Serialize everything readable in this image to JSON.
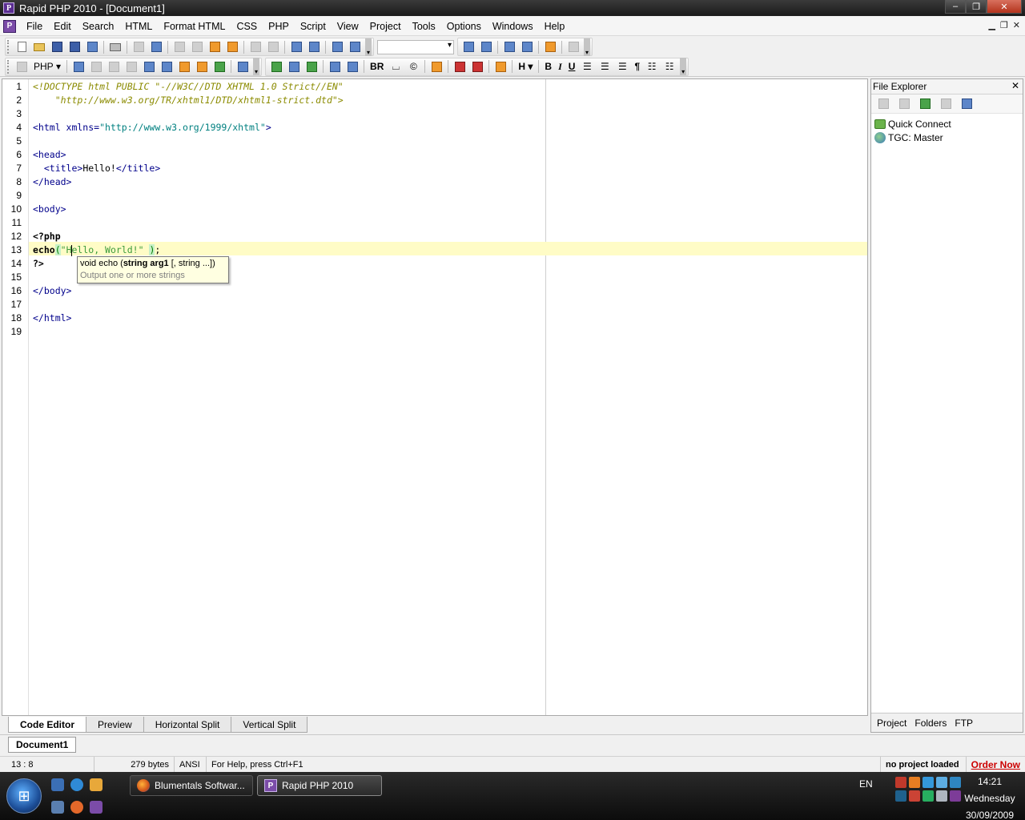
{
  "window": {
    "title": "Rapid PHP 2010 - [Document1]",
    "minimize": "‒",
    "maximize": "❐",
    "close": "✕"
  },
  "menu": [
    "File",
    "Edit",
    "Search",
    "HTML",
    "Format HTML",
    "CSS",
    "PHP",
    "Script",
    "View",
    "Project",
    "Tools",
    "Options",
    "Windows",
    "Help"
  ],
  "toolbar2": {
    "php_label": "PHP",
    "br_label": "BR",
    "h_label": "H",
    "bold": "B",
    "italic": "I",
    "underline": "U",
    "pilcrow": "¶"
  },
  "editor": {
    "lines": [
      {
        "n": "1"
      },
      {
        "n": "2"
      },
      {
        "n": "3"
      },
      {
        "n": "4"
      },
      {
        "n": "5"
      },
      {
        "n": "6"
      },
      {
        "n": "7"
      },
      {
        "n": "8"
      },
      {
        "n": "9"
      },
      {
        "n": "10"
      },
      {
        "n": "11"
      },
      {
        "n": "12"
      },
      {
        "n": "13"
      },
      {
        "n": "14"
      },
      {
        "n": "15"
      },
      {
        "n": "16"
      },
      {
        "n": "17"
      },
      {
        "n": "18"
      },
      {
        "n": "19"
      }
    ],
    "code": {
      "l1": "<!DOCTYPE html PUBLIC \"-//W3C//DTD XHTML 1.0 Strict//EN\"",
      "l2": "    \"http://www.w3.org/TR/xhtml1/DTD/xhtml1-strict.dtd\">",
      "l4_open": "<html xmlns=",
      "l4_val": "\"http://www.w3.org/1999/xhtml\"",
      "l4_close": ">",
      "l6": "<head>",
      "l7_open": "  <title>",
      "l7_text": "Hello!",
      "l7_close": "</title>",
      "l8": "</head>",
      "l10": "<body>",
      "l12": "<?php",
      "l13_kw": "echo",
      "l13_paren_open": "(",
      "l13_str_a": "\"H",
      "l13_str_b": "ello, World!\" ",
      "l13_paren_close": ")",
      "l13_end": ";",
      "l14": "?>",
      "l16": "</body>",
      "l18": "</html>"
    },
    "tooltip": {
      "sig_pre": "void echo (",
      "sig_bold": "string arg1",
      "sig_post": " [, string ...])",
      "desc": "Output one or more strings"
    }
  },
  "editor_tabs": [
    "Code Editor",
    "Preview",
    "Horizontal Split",
    "Vertical Split"
  ],
  "file_explorer": {
    "title": "File Explorer",
    "close": "✕",
    "items": [
      "Quick Connect",
      "TGC: Master"
    ],
    "tabs": [
      "Project",
      "Folders",
      "FTP"
    ]
  },
  "document_tab": "Document1",
  "status": {
    "position": "13 : 8",
    "size": "279 bytes",
    "encoding": "ANSI",
    "help": "For Help, press Ctrl+F1",
    "project": "no project loaded",
    "order": "Order Now"
  },
  "taskbar": {
    "tasks": [
      "Blumentals Softwar...",
      "Rapid PHP 2010"
    ],
    "lang": "EN",
    "time": "14:21",
    "day": "Wednesday",
    "date": "30/09/2009"
  }
}
